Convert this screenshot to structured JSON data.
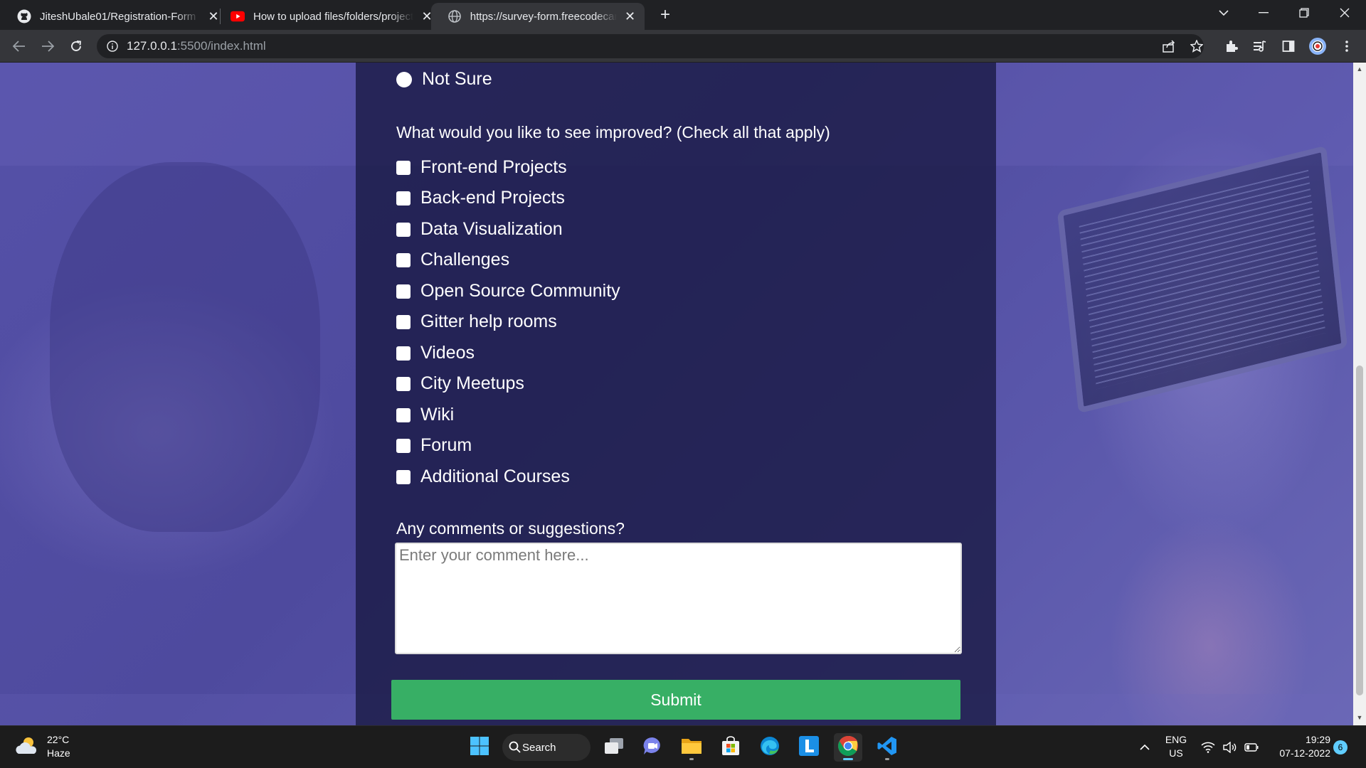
{
  "browser": {
    "tabs": [
      {
        "title": "JiteshUbale01/Registration-Form",
        "favicon": "github-icon",
        "active": false
      },
      {
        "title": "How to upload files/folders/projects",
        "favicon": "youtube-icon",
        "active": false
      },
      {
        "title": "https://survey-form.freecodecamp",
        "favicon": "globe-icon",
        "active": true
      }
    ],
    "address": {
      "host": "127.0.0.1",
      "path": ":5500/index.html"
    }
  },
  "form": {
    "last_radio_label": "Not Sure",
    "improve_question": "What would you like to see improved? (Check all that apply)",
    "improve_options": [
      "Front-end Projects",
      "Back-end Projects",
      "Data Visualization",
      "Challenges",
      "Open Source Community",
      "Gitter help rooms",
      "Videos",
      "City Meetups",
      "Wiki",
      "Forum",
      "Additional Courses"
    ],
    "comments_label": "Any comments or suggestions?",
    "comments_placeholder": "Enter your comment here...",
    "submit_label": "Submit"
  },
  "taskbar": {
    "weather_temp": "22°C",
    "weather_desc": "Haze",
    "search_label": "Search",
    "lang_top": "ENG",
    "lang_bottom": "US",
    "time": "19:29",
    "date": "07-12-2022",
    "notification_count": "6"
  },
  "colors": {
    "submit": "#37af65",
    "panel": "#1b1b46",
    "accent": "#60cdff"
  }
}
